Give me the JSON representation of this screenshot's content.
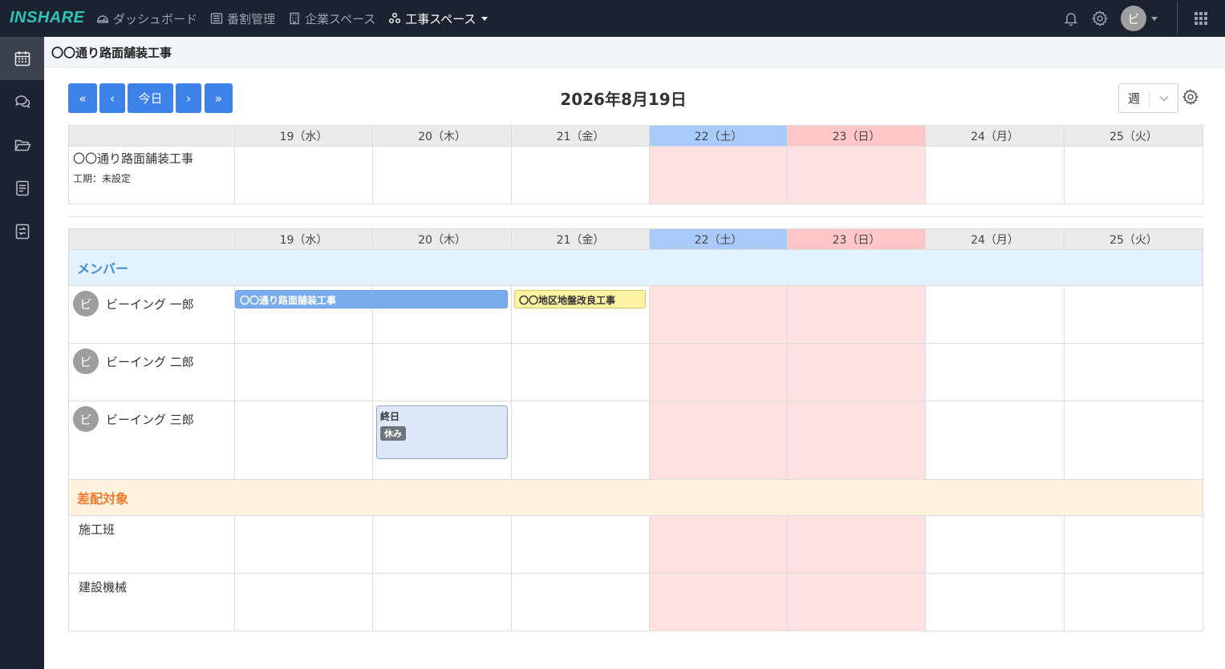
{
  "app": {
    "logo": "INSHARE"
  },
  "nav": {
    "items": [
      {
        "label": "ダッシュボード",
        "icon": "dashboard-icon"
      },
      {
        "label": "番割管理",
        "icon": "list-icon"
      },
      {
        "label": "企業スペース",
        "icon": "building-icon"
      },
      {
        "label": "工事スペース",
        "icon": "network-icon"
      }
    ]
  },
  "user": {
    "avatar_initial": "ビ"
  },
  "sidebar": {
    "items": [
      "calendar-icon",
      "chat-icon",
      "folder-icon",
      "document-icon",
      "exchange-icon"
    ]
  },
  "page": {
    "title": "〇〇通り路面舗装工事"
  },
  "toolbar": {
    "first": "«",
    "prev": "‹",
    "today": "今日",
    "next": "›",
    "last": "»",
    "date": "2026年8月19日",
    "view": "週"
  },
  "days": [
    "19（水）",
    "20（木）",
    "21（金）",
    "22（土）",
    "23（日）",
    "24（月）",
    "25（火）"
  ],
  "project": {
    "name": "〇〇通り路面舗装工事",
    "period": "工期：未設定"
  },
  "sections": {
    "members": "メンバー",
    "targets": "差配対象"
  },
  "members": [
    "ビーイング 一郎",
    "ビーイング 二郎",
    "ビーイング 三郎"
  ],
  "targets": [
    "施工班",
    "建設機械"
  ],
  "events": {
    "e1": "〇〇通り路面舗装工事",
    "e2": "〇〇地区地盤改良工事",
    "leave_title": "終日",
    "leave_badge": "休み"
  },
  "colors": {
    "accent": "#3d82e8",
    "saturday": "#a9cbfb",
    "sunday": "#fec6c6",
    "weekend_bg": "#fee2e2"
  }
}
